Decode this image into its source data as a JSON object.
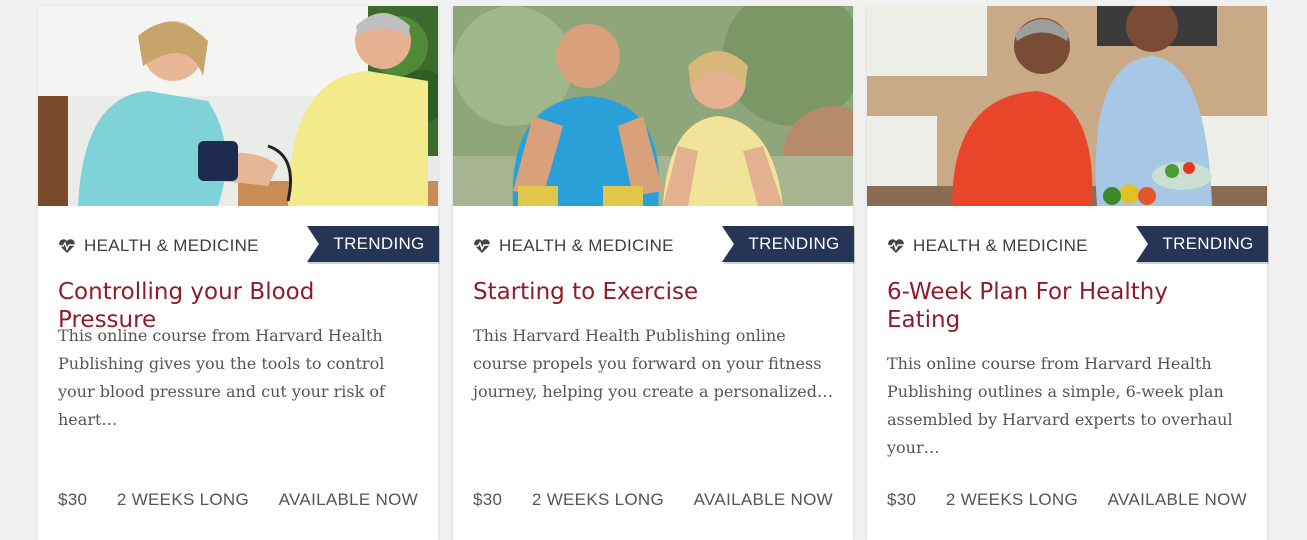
{
  "cards": [
    {
      "image_alt": "woman-blood-pressure-cuff-photo",
      "category": "HEALTH & MEDICINE",
      "category_icon": "heartbeat-icon",
      "badge": "TRENDING",
      "title": "Controlling your Blood Pressure",
      "description": "This online course from Harvard Health Publishing gives you the tools to control your blood pressure and cut your risk of heart…",
      "price": "$30",
      "duration": "2 WEEKS LONG",
      "availability": "AVAILABLE NOW"
    },
    {
      "image_alt": "seniors-stretching-photo",
      "category": "HEALTH & MEDICINE",
      "category_icon": "heartbeat-icon",
      "badge": "TRENDING",
      "title": "Starting to Exercise",
      "description": "This Harvard Health Publishing online course propels you forward on your fitness journey, helping you create a personalized…",
      "price": "$30",
      "duration": "2 WEEKS LONG",
      "availability": "AVAILABLE NOW"
    },
    {
      "image_alt": "couple-cooking-photo",
      "category": "HEALTH & MEDICINE",
      "category_icon": "heartbeat-icon",
      "badge": "TRENDING",
      "title": "6-Week Plan For Healthy Eating",
      "description": "This online course from Harvard Health Publishing outlines a simple, 6-week plan assembled by Harvard experts to overhaul your…",
      "price": "$30",
      "duration": "2 WEEKS LONG",
      "availability": "AVAILABLE NOW"
    }
  ],
  "colors": {
    "title": "#8e1c2c",
    "ribbon": "#263456",
    "body_text": "#555555"
  }
}
